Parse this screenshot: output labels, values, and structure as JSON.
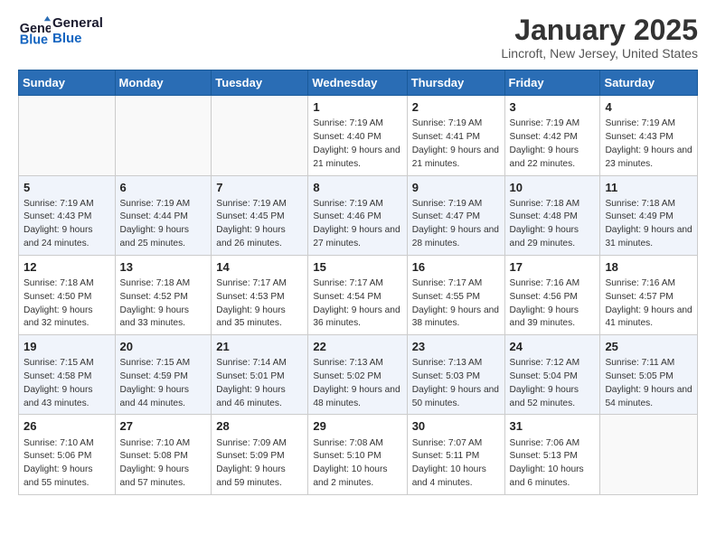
{
  "logo": {
    "line1": "General",
    "line2": "Blue"
  },
  "title": "January 2025",
  "subtitle": "Lincroft, New Jersey, United States",
  "days_header": [
    "Sunday",
    "Monday",
    "Tuesday",
    "Wednesday",
    "Thursday",
    "Friday",
    "Saturday"
  ],
  "weeks": [
    [
      {
        "num": "",
        "info": ""
      },
      {
        "num": "",
        "info": ""
      },
      {
        "num": "",
        "info": ""
      },
      {
        "num": "1",
        "info": "Sunrise: 7:19 AM\nSunset: 4:40 PM\nDaylight: 9 hours and 21 minutes."
      },
      {
        "num": "2",
        "info": "Sunrise: 7:19 AM\nSunset: 4:41 PM\nDaylight: 9 hours and 21 minutes."
      },
      {
        "num": "3",
        "info": "Sunrise: 7:19 AM\nSunset: 4:42 PM\nDaylight: 9 hours and 22 minutes."
      },
      {
        "num": "4",
        "info": "Sunrise: 7:19 AM\nSunset: 4:43 PM\nDaylight: 9 hours and 23 minutes."
      }
    ],
    [
      {
        "num": "5",
        "info": "Sunrise: 7:19 AM\nSunset: 4:43 PM\nDaylight: 9 hours and 24 minutes."
      },
      {
        "num": "6",
        "info": "Sunrise: 7:19 AM\nSunset: 4:44 PM\nDaylight: 9 hours and 25 minutes."
      },
      {
        "num": "7",
        "info": "Sunrise: 7:19 AM\nSunset: 4:45 PM\nDaylight: 9 hours and 26 minutes."
      },
      {
        "num": "8",
        "info": "Sunrise: 7:19 AM\nSunset: 4:46 PM\nDaylight: 9 hours and 27 minutes."
      },
      {
        "num": "9",
        "info": "Sunrise: 7:19 AM\nSunset: 4:47 PM\nDaylight: 9 hours and 28 minutes."
      },
      {
        "num": "10",
        "info": "Sunrise: 7:18 AM\nSunset: 4:48 PM\nDaylight: 9 hours and 29 minutes."
      },
      {
        "num": "11",
        "info": "Sunrise: 7:18 AM\nSunset: 4:49 PM\nDaylight: 9 hours and 31 minutes."
      }
    ],
    [
      {
        "num": "12",
        "info": "Sunrise: 7:18 AM\nSunset: 4:50 PM\nDaylight: 9 hours and 32 minutes."
      },
      {
        "num": "13",
        "info": "Sunrise: 7:18 AM\nSunset: 4:52 PM\nDaylight: 9 hours and 33 minutes."
      },
      {
        "num": "14",
        "info": "Sunrise: 7:17 AM\nSunset: 4:53 PM\nDaylight: 9 hours and 35 minutes."
      },
      {
        "num": "15",
        "info": "Sunrise: 7:17 AM\nSunset: 4:54 PM\nDaylight: 9 hours and 36 minutes."
      },
      {
        "num": "16",
        "info": "Sunrise: 7:17 AM\nSunset: 4:55 PM\nDaylight: 9 hours and 38 minutes."
      },
      {
        "num": "17",
        "info": "Sunrise: 7:16 AM\nSunset: 4:56 PM\nDaylight: 9 hours and 39 minutes."
      },
      {
        "num": "18",
        "info": "Sunrise: 7:16 AM\nSunset: 4:57 PM\nDaylight: 9 hours and 41 minutes."
      }
    ],
    [
      {
        "num": "19",
        "info": "Sunrise: 7:15 AM\nSunset: 4:58 PM\nDaylight: 9 hours and 43 minutes."
      },
      {
        "num": "20",
        "info": "Sunrise: 7:15 AM\nSunset: 4:59 PM\nDaylight: 9 hours and 44 minutes."
      },
      {
        "num": "21",
        "info": "Sunrise: 7:14 AM\nSunset: 5:01 PM\nDaylight: 9 hours and 46 minutes."
      },
      {
        "num": "22",
        "info": "Sunrise: 7:13 AM\nSunset: 5:02 PM\nDaylight: 9 hours and 48 minutes."
      },
      {
        "num": "23",
        "info": "Sunrise: 7:13 AM\nSunset: 5:03 PM\nDaylight: 9 hours and 50 minutes."
      },
      {
        "num": "24",
        "info": "Sunrise: 7:12 AM\nSunset: 5:04 PM\nDaylight: 9 hours and 52 minutes."
      },
      {
        "num": "25",
        "info": "Sunrise: 7:11 AM\nSunset: 5:05 PM\nDaylight: 9 hours and 54 minutes."
      }
    ],
    [
      {
        "num": "26",
        "info": "Sunrise: 7:10 AM\nSunset: 5:06 PM\nDaylight: 9 hours and 55 minutes."
      },
      {
        "num": "27",
        "info": "Sunrise: 7:10 AM\nSunset: 5:08 PM\nDaylight: 9 hours and 57 minutes."
      },
      {
        "num": "28",
        "info": "Sunrise: 7:09 AM\nSunset: 5:09 PM\nDaylight: 9 hours and 59 minutes."
      },
      {
        "num": "29",
        "info": "Sunrise: 7:08 AM\nSunset: 5:10 PM\nDaylight: 10 hours and 2 minutes."
      },
      {
        "num": "30",
        "info": "Sunrise: 7:07 AM\nSunset: 5:11 PM\nDaylight: 10 hours and 4 minutes."
      },
      {
        "num": "31",
        "info": "Sunrise: 7:06 AM\nSunset: 5:13 PM\nDaylight: 10 hours and 6 minutes."
      },
      {
        "num": "",
        "info": ""
      }
    ]
  ]
}
